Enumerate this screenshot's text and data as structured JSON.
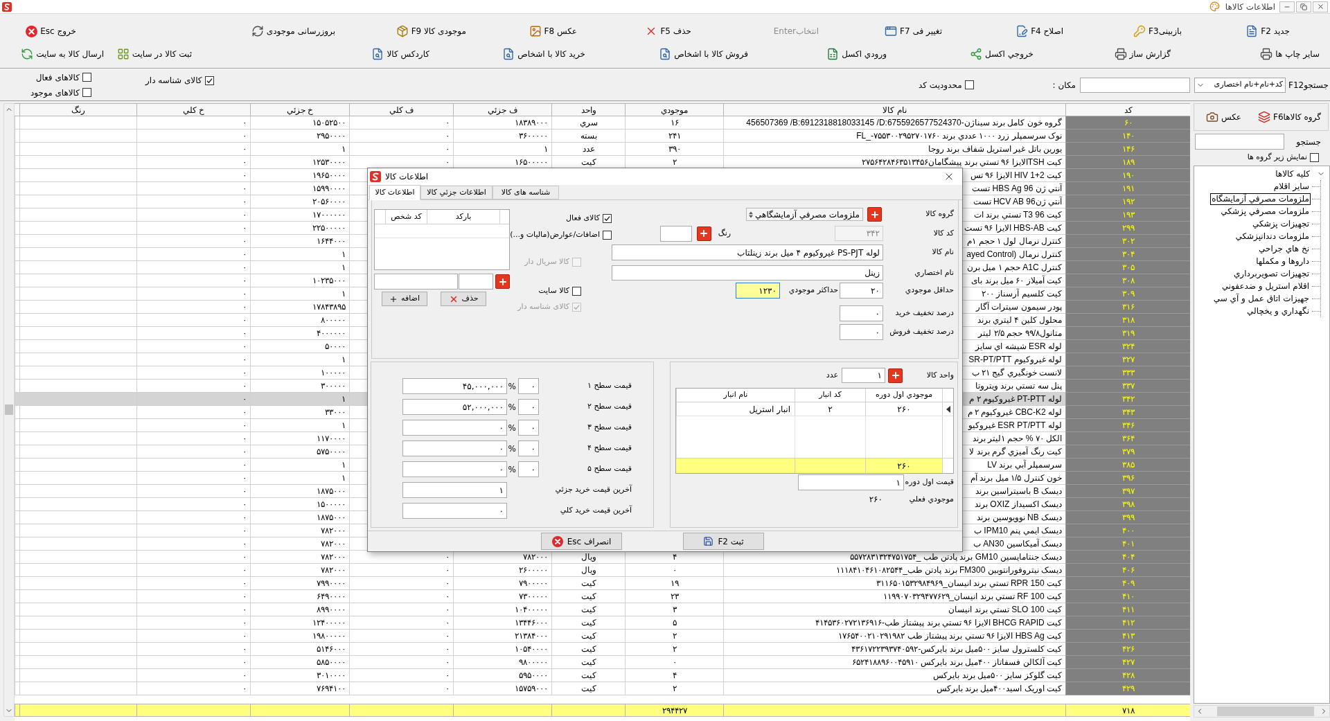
{
  "title_bar": {
    "title": "اطلاعات کالاها"
  },
  "toolbar": {
    "rows": [
      {
        "buttons": [
          {
            "label": "جدید F2",
            "disabled": false
          },
          {
            "label": "بازبینیF3",
            "disabled": false
          },
          {
            "label": "اصلاح F4",
            "disabled": false
          },
          {
            "label": "تغییر فی F7",
            "disabled": false
          },
          {
            "label": "انتخابEnter",
            "disabled": true
          },
          {
            "label": "حذف F5",
            "disabled": false
          },
          {
            "label": "عکس F8",
            "disabled": false
          },
          {
            "label": "موجودی کالا F9",
            "disabled": false
          },
          {
            "label": "بروزرسانی موجودی",
            "disabled": false
          },
          {
            "label": "خروج Esc",
            "disabled": false
          }
        ]
      },
      {
        "buttons": [
          {
            "label": "سایر چاپ ها",
            "disabled": false
          },
          {
            "label": "گزارش ساز",
            "disabled": false
          },
          {
            "label": "خروجي اکسل",
            "disabled": false
          },
          {
            "label": "ورودي اکسل",
            "disabled": false
          },
          {
            "label": "فروش کالا با اشخاص",
            "disabled": false
          },
          {
            "label": "خرید کالا با اشخاص",
            "disabled": false
          },
          {
            "label": "کاردکس کالا",
            "disabled": false
          },
          {
            "label": "ثبت کالا در سایت",
            "disabled": false
          },
          {
            "label": "ارسال کالا به سایت",
            "disabled": false
          }
        ]
      }
    ]
  },
  "filters": {
    "search_label": "F12جستجو",
    "search_mode": "کد+نام+نام اختصاری",
    "location_label": "مکان :",
    "checkboxes": [
      {
        "label": "محدودیت کد",
        "checked": false
      },
      {
        "label": "کالای شناسه دار",
        "checked": true
      },
      {
        "label": "کالاهای فعال",
        "checked": false
      },
      {
        "label": "کالاهای موجود",
        "checked": false
      }
    ]
  },
  "sidebar": {
    "buttons": [
      {
        "label": "گروه کالاهاF6"
      },
      {
        "label": "عکس"
      }
    ],
    "search_label": "جستجو",
    "show_subgroups": {
      "label": "نمایش زیر گروه ها",
      "checked": false
    },
    "tree": [
      {
        "label": "کلیه کالاها",
        "expanded": true,
        "selected": false,
        "children": [
          {
            "label": "سایر اقلام",
            "selected": false
          },
          {
            "label": "ملزومات مصرفي آزمایشگاه",
            "selected": true
          },
          {
            "label": "ملزومات مصرفي پزشکي",
            "selected": false
          },
          {
            "label": "تجهیزات پزشکي",
            "selected": false
          },
          {
            "label": "ملزومات دندانپزشکي",
            "selected": false
          },
          {
            "label": "نخ هاي جراحي",
            "selected": false
          },
          {
            "label": "داروها و مکملها",
            "selected": false
          },
          {
            "label": "تجهیزات تصویربرداري",
            "selected": false
          },
          {
            "label": "اقلام استریل و ضدعفوني",
            "selected": false
          },
          {
            "label": "جهیزات اتاق عمل و آي سي",
            "selected": false
          },
          {
            "label": "نگهداري و یخچالي",
            "selected": false
          }
        ]
      }
    ]
  },
  "table": {
    "columns": [
      "کد",
      "نام کالا",
      "موجودي",
      "واحد",
      "ف جزئي",
      "ف کلي",
      "خ جزئي",
      "خ کلي",
      "رنگ"
    ],
    "rows": [
      {
        "code": "۶۰",
        "name": "456507369 /B:6912318818033145 /D:6755926577524370-گروه خون کامل برند سیناژن",
        "stock": "۱۶",
        "unit": "سري",
        "sale_retail": "۱۸۳۸۹۰۰۰",
        "sale_wholesale": "۰",
        "buy_retail": "۱۵۰۵۲۵۰۰",
        "buy_wholesale": "۰",
        "selected": false
      },
      {
        "code": "۱۴۰",
        "name": "نوک سرسمپلر زرد ۱۰۰۰ عددي برند FL_-۷۵۵۳۰۰۲۹۵۲۷۰۱۷۶۰",
        "stock": "۲۴۱",
        "unit": "بسته",
        "sale_retail": "۳۶۰۰۰۰۰",
        "sale_wholesale": "۰",
        "buy_retail": "۲۹۵۰۰۰۰",
        "buy_wholesale": "۰",
        "selected": false
      },
      {
        "code": "۱۴۶",
        "name": "یورین باتل غیر استریل شفاف برند روجا",
        "stock": "۳۹۰",
        "unit": "عدد",
        "sale_retail": "۱",
        "sale_wholesale": "۰",
        "buy_retail": "۱",
        "buy_wholesale": "۰",
        "selected": false
      },
      {
        "code": "۱۸۹",
        "name": "کیت TSHالایزا ۹۶ تستي برند پیشگامان۲۷۵۶۴۲۸۴۶۳۵۱۳۴۵۶",
        "stock": "۲",
        "unit": "کیت",
        "sale_retail": "۱۶۵۰۰۰۰۰",
        "sale_wholesale": "۰",
        "buy_retail": "۱۲۵۳۰۰۰۰",
        "buy_wholesale": "۰",
        "selected": false
      },
      {
        "code": "۱۹۰",
        "name": "کیت 2+1 HIV الایزا ۹۶ تس",
        "buy_retail": "۱۹۶۵۰۰۰۰",
        "buy_wholesale": "۰",
        "selected": false
      },
      {
        "code": "۱۹۱",
        "name": "آنتي ژن HBS Ag 96 تست",
        "buy_retail": "۱۵۹۹۰۰۰۰",
        "buy_wholesale": "۰",
        "selected": false
      },
      {
        "code": "۱۹۲",
        "name": "آنتي ژنHCV AB 96 تست",
        "buy_retail": "۲۰۵۶۰۰۰۰",
        "buy_wholesale": "۰",
        "selected": false
      },
      {
        "code": "۱۹۳",
        "name": "کیت T3 96 تستي برند ات",
        "buy_retail": "۱۷۰۰۰۰۰۰",
        "buy_wholesale": "۰",
        "selected": false
      },
      {
        "code": "۲۹۹",
        "name": "کیت HBS-AB الایزا ۹۶ تست",
        "buy_retail": "۲۲۵۰۰۰۰۰",
        "buy_wholesale": "۰",
        "selected": false
      },
      {
        "code": "۳۰۲",
        "name": "کنترل نرمال لول ۱ حجم ۱م",
        "buy_retail": "۱۶۴۴۰۰۰",
        "buy_wholesale": "۰",
        "selected": false
      },
      {
        "code": "۳۰۴",
        "name": "کنترل نرمال (ayed Control",
        "buy_retail": "۱",
        "buy_wholesale": "۰",
        "selected": false
      },
      {
        "code": "۳۰۵",
        "name": "کنترل A1C حجم ۱ میل برن",
        "buy_retail": "۱",
        "buy_wholesale": "۰",
        "selected": false
      },
      {
        "code": "۳۰۸",
        "name": "کیت آمیلاز ۶۰ میل برند بای",
        "buy_retail": "۱۰۲۳۵۰۰۰",
        "buy_wholesale": "۰",
        "selected": false
      },
      {
        "code": "۳۰۹",
        "name": "کیت کلسیم آرسناز ۲۰۰",
        "buy_retail": "۱",
        "buy_wholesale": "۰",
        "selected": false
      },
      {
        "code": "۳۱۶",
        "name": "پودر سیمون سیترات آگار",
        "buy_retail": "۱۷۸۴۳۸۹۵",
        "buy_wholesale": "۰",
        "selected": false
      },
      {
        "code": "۳۱۸",
        "name": "محلول کلین ۴ لیتري برند",
        "buy_retail": "۸۰۰۰۰۰",
        "buy_wholesale": "۰",
        "selected": false
      },
      {
        "code": "۳۱۹",
        "name": "متانول۹۹/۸ حجم ۲/۵ لیتر",
        "buy_retail": "۴۰۰۰۰۰۰",
        "buy_wholesale": "۰",
        "selected": false
      },
      {
        "code": "۳۲۴",
        "name": "لوله ESR شیشه اي سایز",
        "buy_retail": "۵۰۰۰۰",
        "buy_wholesale": "۰",
        "selected": false
      },
      {
        "code": "۳۲۷",
        "name": "لوله غیروکیوم SR-PT/PTT",
        "buy_retail": "۱",
        "buy_wholesale": "۰",
        "selected": false
      },
      {
        "code": "۳۳۳",
        "name": "لانست خونگیري گیج ۲۱ ب",
        "buy_retail": "۱۰۰۰۰۰",
        "buy_wholesale": "۰",
        "selected": false
      },
      {
        "code": "۳۳۷",
        "name": "پنل سه تستي برند ویتروتا",
        "buy_retail": "۳۰۰۰۰۰",
        "buy_wholesale": "۰",
        "selected": false
      },
      {
        "code": "۳۴۲",
        "name": "لوله PT-PTT غیروکیوم ۲ م",
        "buy_retail": "۱",
        "buy_wholesale": "۰",
        "selected": true
      },
      {
        "code": "۳۴۳",
        "name": "لوله CBC-K2 غیروکیوم ۲ م",
        "buy_retail": "۳۳۰۰۰",
        "buy_wholesale": "۰",
        "selected": false
      },
      {
        "code": "۳۴۶",
        "name": "لوله ESR PT/PTT غیروکیو",
        "buy_retail": "۱",
        "buy_wholesale": "۰",
        "selected": false
      },
      {
        "code": "۳۶۴",
        "name": "الکل ۷۰ % حجم ۱لیتر برند",
        "buy_retail": "۱۱۷۰۰۰۰",
        "buy_wholesale": "۰",
        "selected": false
      },
      {
        "code": "۳۷۹",
        "name": "کیت رنگ آمیزي گرم برند لا",
        "buy_retail": "۵۷۵۰۰۰۰",
        "buy_wholesale": "۰",
        "selected": false
      },
      {
        "code": "۳۸۵",
        "name": "سرسمپلر آبي برند LV",
        "buy_retail": "۱",
        "buy_wholesale": "۰",
        "selected": false
      },
      {
        "code": "۳۹۶",
        "name": "خون کنترل ۱/۵ میل برند آم",
        "buy_retail": "۱",
        "buy_wholesale": "۰",
        "selected": false
      },
      {
        "code": "۳۹۷",
        "name": "دیسک B باسیتراسین برند",
        "buy_retail": "۱۸۷۵۰۰۰",
        "buy_wholesale": "۰",
        "selected": false
      },
      {
        "code": "۳۹۸",
        "name": "دیسک اکسیداز OXIZ  برند",
        "buy_retail": "۱۵۰۰۰۰۰",
        "buy_wholesale": "۰",
        "selected": false
      },
      {
        "code": "۳۹۹",
        "name": "دیسک NB نوویوسین برند",
        "buy_retail": "۱۸۷۵۰۰۰",
        "buy_wholesale": "۰",
        "selected": false
      },
      {
        "code": "۴۰۰",
        "name": "دیسک ایمي پنم IPM10  ب",
        "buy_retail": "۷۸۲۰۰۰",
        "buy_wholesale": "۰",
        "selected": false
      },
      {
        "code": "۴۰۱",
        "name": "دیسک آمیکاسین AN30  ب",
        "buy_retail": "۷۸۲۰۰۰",
        "buy_wholesale": "۰",
        "selected": false
      },
      {
        "code": "۴۰۴",
        "name": "دیسک جنتامایسین GM10  برند پادتن طب _۵۵۷۲۸۳۱۳۲۴۷۵۱۷۵۴",
        "stock": "۴",
        "unit": "ویال",
        "sale_retail": "۷۸۲۰۰۰",
        "sale_wholesale": "۰",
        "buy_retail": "۷۸۲۰۰۰",
        "buy_wholesale": "۰",
        "selected": false
      },
      {
        "code": "۴۰۶",
        "name": "دیسک نیتروفورانتوبین FM300  برند پادتن طب_۱۱۱۸۴۱۰۴۶۱۰۸۲۵۴۴",
        "stock": "۰",
        "unit": "ویال",
        "sale_retail": "۲۶۰۰۰۰۰",
        "sale_wholesale": "۰",
        "buy_retail": "۷۸۲۰۰۰",
        "buy_wholesale": "۰",
        "selected": false
      },
      {
        "code": "۴۰۹",
        "name": "کیت RPR 150 تستي برند انیسان_۳۱۱۶۵۰۱۵۳۲۹۸۴۹۶۹",
        "stock": "۱۹",
        "unit": "کیت",
        "sale_retail": "۷۹۰۰۰۰۰",
        "sale_wholesale": "۰",
        "buy_retail": "۷۹۹۰۰۰۰",
        "buy_wholesale": "۰",
        "selected": false
      },
      {
        "code": "۴۱۰",
        "name": "کیت RF 100 تستي برند انیسان_۱۱۹۹۰۷۰۳۲۹۴۷۷۶۲۹",
        "stock": "۲۳",
        "unit": "کیت",
        "sale_retail": "۷۳۰۰۰۰۰",
        "sale_wholesale": "۰",
        "buy_retail": "۶۴۹۰۰۰۰",
        "buy_wholesale": "۰",
        "selected": false
      },
      {
        "code": "۴۱۱",
        "name": "کیت SLO 100 تستي برند انیسان",
        "stock": "۳",
        "unit": "کیت",
        "sale_retail": "۱۰۴۰۰۰۰۰",
        "sale_wholesale": "۰",
        "buy_retail": "۸۹۹۰۰۰۰",
        "buy_wholesale": "۰",
        "selected": false
      },
      {
        "code": "۴۱۲",
        "name": "کیت BHCG RAPID الایزا ۹۶ تستي برند پیشتاز طب-۴۱۴۵۳۶۰۲۷۲۱۳۶۹۱۶",
        "stock": "۵",
        "unit": "کیت",
        "sale_retail": "۱۳۴۴۶۰۰۰",
        "sale_wholesale": "۰",
        "buy_retail": "۱۲۴۰۰۰۰۰",
        "buy_wholesale": "۰",
        "selected": false
      },
      {
        "code": "۴۱۳",
        "name": "کیت HBS Ag الایزا ۹۶ تستي برند پیشتاز طب ۱۷۶۵۴۰۰۲۱۰۲۹۱۹۸۲",
        "stock": "۲",
        "unit": "کیت",
        "sale_retail": "۲۱۳۸۴۰۰۰",
        "sale_wholesale": "۰",
        "buy_retail": "۱۹۸۰۰۰۰۰",
        "buy_wholesale": "۰",
        "selected": false
      },
      {
        "code": "۴۲۶",
        "name": "کیت کلسترول سایز ۵۰۰میل برند بایرکس-۴۳۶۱۷۲۲۳۹۳۷۴۰۵۹۲",
        "stock": "۲",
        "unit": "کیت",
        "sale_retail": "۱۰۵۴۰۰۰۰",
        "sale_wholesale": "۰",
        "buy_retail": "۵۱۴۶۰۰۰",
        "buy_wholesale": "۰",
        "selected": false
      },
      {
        "code": "۴۲۷",
        "name": "کیت آلکالن فسفاتاز ۴۰۰میل برند بایرکس ۶۵۲۴۱۸۸۹۶۰۰۴۵۹۱۰",
        "stock": "۰",
        "unit": "کیت",
        "sale_retail": "۹۸۰۰۰۰۰",
        "sale_wholesale": "۰",
        "buy_retail": "۵۸۵۰۰۰۰",
        "buy_wholesale": "۰",
        "selected": false
      },
      {
        "code": "۴۲۸",
        "name": "کیت گلوکز سایز ۵۰۰میل برند بایرکس",
        "stock": "۴",
        "unit": "کیت",
        "sale_retail": "۵۹۵۰۰۰۰",
        "sale_wholesale": "۰",
        "buy_retail": "۳۰۱۰۰۰۰",
        "buy_wholesale": "۰",
        "selected": false
      },
      {
        "code": "۴۲۹",
        "name": "کیت اوریک اسید۴۰۰میل برند بایرکس",
        "stock": "۲",
        "unit": "کیت",
        "sale_retail": "۱۵۷۵۹۰۰۰",
        "sale_wholesale": "۰",
        "buy_retail": "۷۶۹۴۱۰۰",
        "buy_wholesale": "۰",
        "selected": false
      }
    ],
    "totals": {
      "code": "۷۱۸",
      "stock": "۲۹۴۴۲۷"
    }
  },
  "dialog": {
    "title": "اطلاعات کالا",
    "tabs": [
      {
        "label": "شناسه های کالا",
        "selected": false
      },
      {
        "label": "اطلاعات جزئي کالا",
        "selected": false
      },
      {
        "label": "اطلاعات کالا",
        "selected": true
      }
    ],
    "group": {
      "label": "گروه کالا",
      "value": "ملزومات مصرفي آزمایشگاهي"
    },
    "code": {
      "label": "کد کالا",
      "value": "۳۴۲",
      "disabled": true
    },
    "color": {
      "label": "رنگ"
    },
    "name": {
      "label": "نام کالا",
      "value": "لوله PS-PJT غیروکیوم ۴ میل برند زینلتاب"
    },
    "short_name": {
      "label": "نام اختصاري",
      "value": "زینل"
    },
    "min_stock": {
      "label": "حداقل موجودي",
      "value": "۲۰"
    },
    "max_stock": {
      "label": "حداکثر موجودي",
      "value": "۱۲۳۰",
      "focused": true
    },
    "purchase_discount": {
      "label": "درصد تخفیف خرید",
      "value": "۰"
    },
    "sale_discount": {
      "label": "درصد تخفیف فروش",
      "value": "۰"
    },
    "options": [
      {
        "label": "کالای فعال",
        "checked": true,
        "disabled": false
      },
      {
        "label": "اضافات/عوارض(مالیات و...)",
        "checked": false,
        "disabled": false
      },
      {
        "label": "کالا سریال دار",
        "checked": false,
        "disabled": true
      },
      {
        "label": "کالا سایت",
        "checked": false,
        "disabled": false
      },
      {
        "label": "کالای شناسه دار",
        "checked": true,
        "disabled": true
      }
    ],
    "barcodes": {
      "columns": [
        "بارکد",
        "کد شخص"
      ],
      "buttons": [
        {
          "label": "حذف",
          "kind": "delete"
        },
        {
          "label": "اضافه",
          "kind": "add"
        }
      ]
    },
    "prices": [
      {
        "label": "قیمت سطح ۱",
        "percent": "۰",
        "percent_sign": "%",
        "value": "۴۵,۰۰۰,۰۰۰"
      },
      {
        "label": "قیمت سطح ۲",
        "percent": "۰",
        "percent_sign": "%",
        "value": "۵۲,۰۰۰,۰۰۰"
      },
      {
        "label": "قیمت سطح ۳",
        "percent": "۰",
        "percent_sign": "%",
        "value": "۰"
      },
      {
        "label": "قیمت سطح ۴",
        "percent": "۰",
        "percent_sign": "%",
        "value": "۰"
      },
      {
        "label": "قیمت سطح ۵",
        "percent": "۰",
        "percent_sign": "%",
        "value": "۰"
      }
    ],
    "last_prices": [
      {
        "label": "آخرین قیمت خرید جزئي",
        "value": "۱"
      },
      {
        "label": "آخرین قیمت خرید کلي",
        "value": "۰"
      }
    ],
    "unit": {
      "label": "واحد کالا",
      "value": "۱",
      "name": "عدد"
    },
    "warehouses": {
      "columns": [
        "موجودي اول دوره",
        "کد انبار",
        "نام انبار"
      ],
      "rows": [
        {
          "opening_stock": "۲۶۰",
          "code": "۲",
          "name": "انبار استریل",
          "selected": true
        }
      ],
      "total": "۲۶۰"
    },
    "opening_price": {
      "label": "قیمت اول دوره",
      "value": "۱"
    },
    "current_stock": {
      "label": "موجودي فعلي",
      "value": "۲۶۰"
    },
    "buttons": [
      {
        "label": "ثبت F2",
        "kind": "save"
      },
      {
        "label": "انصراف Esc",
        "kind": "cancel"
      }
    ]
  }
}
